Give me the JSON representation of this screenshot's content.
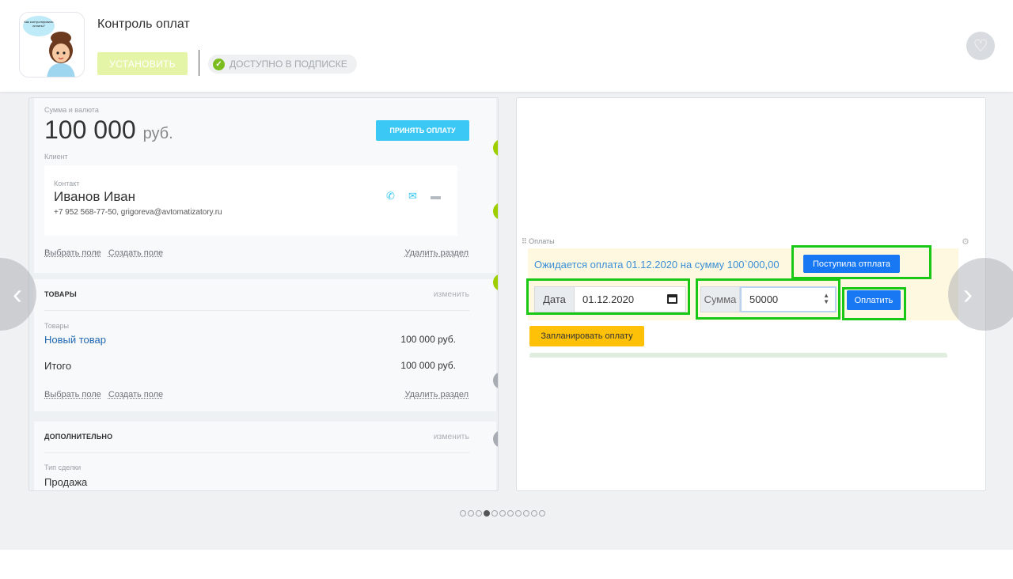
{
  "app": {
    "title": "Контроль оплат",
    "icon_bubble_text": "Как контролировать оплаты?",
    "install_label": "УСТАНОВИТЬ",
    "subscription_label": "ДОСТУПНО В ПОДПИСКЕ",
    "favorite_icon": "heart-icon",
    "install_color": "#e4f5a8",
    "badge_check_color": "#7cbd1e"
  },
  "gallery": {
    "prev_icon": "chevron-left-icon",
    "next_icon": "chevron-right-icon",
    "pager": {
      "total": 11,
      "active_index": 3
    }
  },
  "deal": {
    "sum_label": "Сумма и валюта",
    "sum_value": "100 000",
    "sum_currency": "руб.",
    "accept_payment_label": "ПРИНЯТЬ ОПЛАТУ",
    "client_label": "Клиент",
    "contact_label": "Контакт",
    "contact_name": "Иванов Иван",
    "contact_info": "+7 952 568-77-50, grigoreva@avtomatizatory.ru",
    "select_field": "Выбрать поле",
    "create_field": "Создать поле",
    "delete_section": "Удалить раздел",
    "goods": {
      "header": "ТОВАРЫ",
      "edit": "изменить",
      "sub_label": "Товары",
      "item_name": "Новый товар",
      "item_price": "100 000 руб.",
      "total_label": "Итого",
      "total_value": "100 000 руб."
    },
    "extra": {
      "header": "ДОПОЛНИТЕЛЬНО",
      "edit": "изменить",
      "deal_type_label": "Тип сделки",
      "deal_type_value": "Продажа"
    }
  },
  "payments": {
    "widget_label": "Оплаты",
    "expected_text": "Ожидается оплата 01.12.2020 на сумму 100`000,00",
    "received_button": "Поступила отплата",
    "date_label": "Дата",
    "date_value": "01.12.2020",
    "sum_label": "Сумма",
    "sum_value": "50000",
    "pay_button": "Оплатить",
    "schedule_button": "Запланировать оплату",
    "highlight_color": "#19c814",
    "accent_color": "#1877f2"
  }
}
